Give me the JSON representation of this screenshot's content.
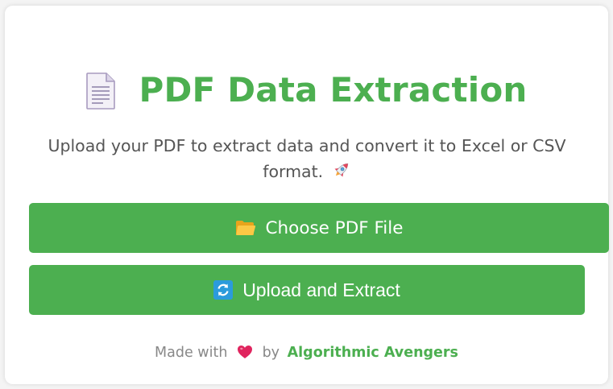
{
  "header": {
    "title": "PDF Data Extraction",
    "icon": "document-icon"
  },
  "subtitle": {
    "text": "Upload your PDF to extract data and convert it to Excel or CSV format.",
    "icon": "rocket-icon"
  },
  "buttons": {
    "choose_label": "Choose PDF File",
    "choose_icon": "folder-icon",
    "upload_label": "Upload and Extract",
    "upload_icon": "refresh-icon"
  },
  "footer": {
    "made_with": "Made with",
    "by": "by",
    "brand": "Algorithmic Avengers",
    "icon": "heart-icon"
  },
  "colors": {
    "accent": "#4caf50",
    "text": "#555555",
    "muted": "#888888"
  }
}
